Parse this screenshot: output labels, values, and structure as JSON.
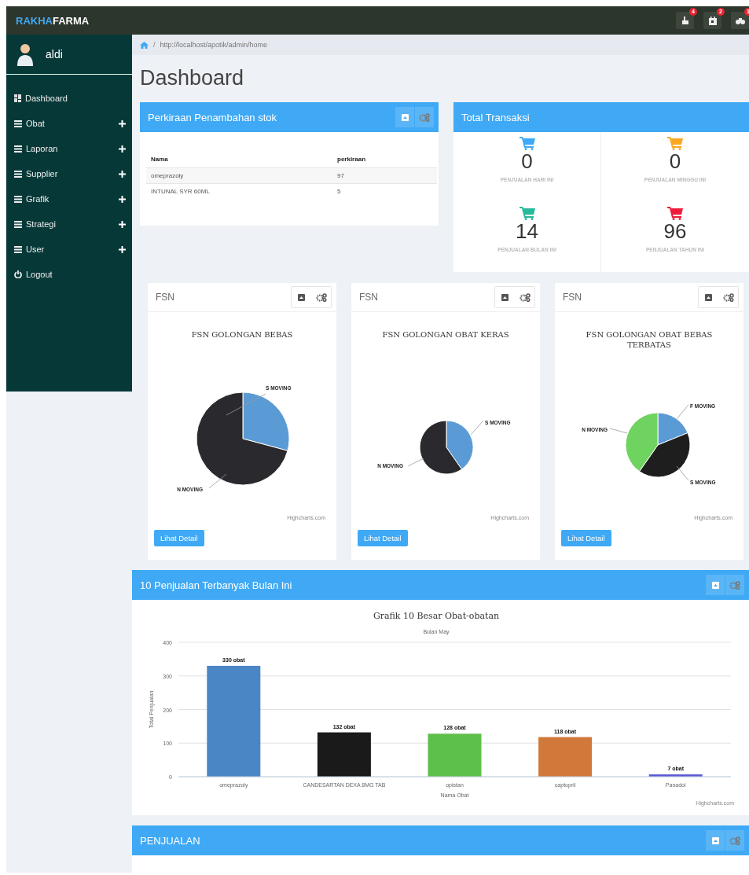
{
  "topbar": {
    "brand_first": "RAKHA",
    "brand_second": "FARMA",
    "notifications": [
      {
        "kind": "hand",
        "badge": "4"
      },
      {
        "kind": "calendar",
        "badge": "2"
      },
      {
        "kind": "binoculars",
        "badge": "1"
      }
    ]
  },
  "sidebar": {
    "user": "aldi",
    "items": [
      {
        "kind": "dashboard",
        "label": "Dashboard"
      },
      {
        "kind": "group",
        "label": "Obat"
      },
      {
        "kind": "group",
        "label": "Laporan"
      },
      {
        "kind": "group",
        "label": "Supplier"
      },
      {
        "kind": "group",
        "label": "Grafik"
      },
      {
        "kind": "group",
        "label": "Strategi"
      },
      {
        "kind": "group",
        "label": "User"
      },
      {
        "kind": "logout",
        "label": "Logout"
      }
    ]
  },
  "breadcrumb_separator": "/",
  "breadcrumb": "http://localhost/apotik/admin/home",
  "page_title": "Dashboard",
  "stock_panel": {
    "title": "Perkiraan Penambahan stok",
    "columns": [
      "Nama",
      "perkiraan"
    ],
    "rows": [
      [
        "omeprazoly",
        "97"
      ],
      [
        "INTUNAL SYR 60ML",
        "5"
      ]
    ]
  },
  "transactions_panel": {
    "title": "Total Transaksi",
    "stats": [
      {
        "value": "0",
        "label": "PENJUALAN HARI INI",
        "color": "#3fa9f5"
      },
      {
        "value": "0",
        "label": "PENJUALAN MINGGU INI",
        "color": "#f9a825"
      },
      {
        "value": "14",
        "label": "PENJUALAN BULAN INI",
        "color": "#26b99a"
      },
      {
        "value": "96",
        "label": "PENJUALAN TAHUN INI",
        "color": "#ee1c3a"
      }
    ]
  },
  "fsn_panels": [
    {
      "title": "FSN",
      "chart_title": "FSN GOLONGAN BEBAS",
      "slice_labels": [
        "S MOVING",
        "N MOVING"
      ],
      "credit": "Highcharts.com",
      "button": "Lihat Detail"
    },
    {
      "title": "FSN",
      "chart_title": "FSN GOLONGAN OBAT KERAS",
      "slice_labels": [
        "S MOVING",
        "N MOVING"
      ],
      "credit": "Highcharts.com",
      "button": "Lihat Detail"
    },
    {
      "title": "FSN",
      "chart_title": "FSN GOLONGAN OBAT BEBAS TERBATAS",
      "slice_labels": [
        "F MOVING",
        "N MOVING",
        "S MOVING"
      ],
      "credit": "Highcharts.com",
      "button": "Lihat Detail"
    }
  ],
  "top_sales_panel": {
    "title": "10 Penjualan Terbanyak Bulan Ini",
    "credit": "Highcharts.com",
    "chart_data": {
      "type": "bar",
      "title": "Grafik 10 Besar Obat-obatan",
      "subtitle": "Bulan May",
      "xlabel": "Nama Obat",
      "ylabel": "Total Penjualan",
      "categories": [
        "omeprazoly",
        "CANDESARTAN DEXA 8MG TAB",
        "opistan",
        "captopril",
        "Panadol"
      ],
      "series": [
        {
          "color": "#4a86c5",
          "values": [
            330,
            null,
            null,
            null,
            null
          ]
        },
        {
          "color": "#1a1a1a",
          "values": [
            null,
            132,
            null,
            null,
            null
          ]
        },
        {
          "color": "#5cc04a",
          "values": [
            null,
            null,
            128,
            null,
            null
          ]
        },
        {
          "color": "#d0793a",
          "values": [
            null,
            null,
            null,
            118,
            null
          ]
        },
        {
          "color": "#5b5bd6",
          "values": [
            null,
            null,
            null,
            null,
            7
          ]
        }
      ],
      "stacked": true,
      "grid": true,
      "ylim": [
        0,
        400
      ],
      "yticks": [
        0,
        100,
        200,
        300,
        400
      ],
      "value_labels": [
        "330 obat",
        "132 obat",
        "128 obat",
        "118 obat",
        "7 obat"
      ]
    }
  },
  "sales_panel": {
    "title": "PENJUALAN"
  }
}
